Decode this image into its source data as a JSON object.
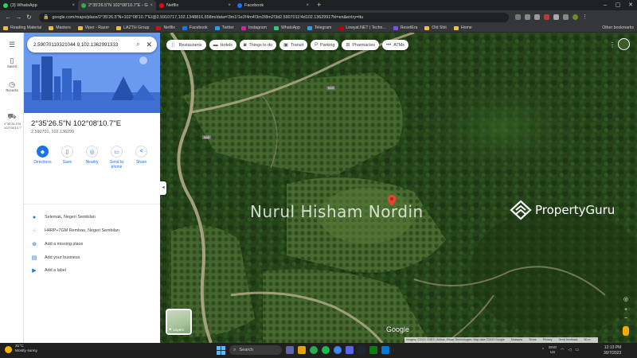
{
  "browser": {
    "tabs": [
      {
        "title": "(3) WhatsApp",
        "color": "#25d366",
        "active": false
      },
      {
        "title": "2°35'26.5\"N 102°08'10.7\"E - Goo",
        "color": "#34a853",
        "active": true
      },
      {
        "title": "Netflix",
        "color": "#e50914",
        "active": false
      },
      {
        "title": "Facebook",
        "color": "#1877f2",
        "active": false
      }
    ],
    "url": "google.com/maps/place/2°35'26.5\"N+102°08'10.7\"E/@2.5910717,102.1348816,658m/data=!3m1!1e3!4m4!3m3!8m2!3d2.5907011!4d102.1362991?hl=en&entry=ttu",
    "bookmarks": [
      {
        "label": "Reading Material",
        "color": "#f0c040"
      },
      {
        "label": "Masters",
        "color": "#f0c040"
      },
      {
        "label": "Viper - Razer",
        "color": "#f0c040"
      },
      {
        "label": "LAZTH Group",
        "color": "#f0c040"
      },
      {
        "label": "Netflix",
        "color": "#e50914"
      },
      {
        "label": "Facebook",
        "color": "#1877f2"
      },
      {
        "label": "Twitter",
        "color": "#1da1f2"
      },
      {
        "label": "Instagram",
        "color": "#d6249f"
      },
      {
        "label": "WhatsApp",
        "color": "#25d366"
      },
      {
        "label": "Telegram",
        "color": "#2aa3e0"
      },
      {
        "label": "Lowyat.NET | Techn...",
        "color": "#c00000"
      },
      {
        "label": "ResetEra",
        "color": "#7c4dff"
      },
      {
        "label": "Old Shit",
        "color": "#f0c040"
      },
      {
        "label": "Home",
        "color": "#f0c040"
      }
    ],
    "other_bookmarks": "Other bookmarks"
  },
  "rail": {
    "saved": "Saved",
    "recents": "Recents",
    "recent_place": "2°35'26.5\"N 102°08'10.7\""
  },
  "panel": {
    "search_value": "2.59070110321044 9,102.1362991333",
    "title": "2°35'26.5\"N 102°08'10.7\"E",
    "subtitle": "2.590701, 102.136299",
    "actions": [
      {
        "label": "Directions",
        "icon": "directions-icon",
        "glyph": "◆"
      },
      {
        "label": "Save",
        "icon": "bookmark-icon",
        "glyph": "▯"
      },
      {
        "label": "Nearby",
        "icon": "nearby-icon",
        "glyph": "◎"
      },
      {
        "label": "Send to phone",
        "icon": "phone-icon",
        "glyph": "▭"
      },
      {
        "label": "Share",
        "icon": "share-icon",
        "glyph": "<"
      }
    ],
    "info": [
      {
        "text": "Selemak, Negeri Sembilan",
        "icon": "location-pin-icon",
        "glyph": "●"
      },
      {
        "text": "H4RP+7GM Rembau, Negeri Sembilan",
        "icon": "plus-code-icon",
        "glyph": "⁘"
      },
      {
        "text": "Add a missing place",
        "icon": "add-place-icon",
        "glyph": "⊕"
      },
      {
        "text": "Add your business",
        "icon": "business-icon",
        "glyph": "▤"
      },
      {
        "text": "Add a label",
        "icon": "label-icon",
        "glyph": "▶"
      }
    ]
  },
  "map": {
    "chips": [
      {
        "label": "Restaurants",
        "icon": "restaurant-icon",
        "glyph": "🍴"
      },
      {
        "label": "Hotels",
        "icon": "hotel-icon",
        "glyph": "▬"
      },
      {
        "label": "Things to do",
        "icon": "camera-icon",
        "glyph": "◙"
      },
      {
        "label": "Transit",
        "icon": "transit-icon",
        "glyph": "▣"
      },
      {
        "label": "Parking",
        "icon": "parking-icon",
        "glyph": "P"
      },
      {
        "label": "Pharmacies",
        "icon": "pharmacy-icon",
        "glyph": "⊞"
      },
      {
        "label": "ATMs",
        "icon": "atm-icon",
        "glyph": "•••"
      }
    ],
    "road_labels": [
      "N15",
      "N15"
    ],
    "watermark": "Nurul Hisham Nordin",
    "brand": "PropertyGuru",
    "layers_label": "Layers",
    "google_logo": "Google",
    "attribution": [
      "Imagery ©2023 CNES / Airbus, Maxar Technologies, Map data ©2023 Google",
      "Malaysia",
      "Terms",
      "Privacy",
      "Send feedback",
      "50 m"
    ]
  },
  "taskbar": {
    "temperature": "31°C",
    "weather": "Mostly sunny",
    "search": "Search",
    "lang_top": "ENG",
    "lang_bottom": "US",
    "time": "12:13 PM",
    "date": "30/7/2023"
  }
}
